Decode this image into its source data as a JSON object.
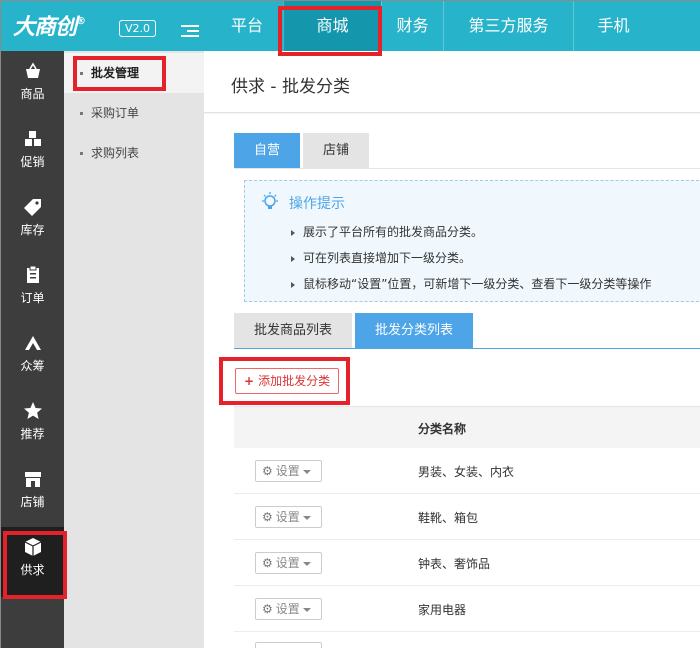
{
  "header": {
    "logo": "大商创",
    "logo_mark": "®",
    "version": "V2.0",
    "nav": [
      {
        "label": "平台"
      },
      {
        "label": "商城"
      },
      {
        "label": "财务"
      },
      {
        "label": "第三方服务"
      },
      {
        "label": "手机"
      }
    ],
    "active_nav": "商城"
  },
  "sidebar": {
    "items": [
      {
        "label": "商品",
        "icon": "basket-icon"
      },
      {
        "label": "促销",
        "icon": "blocks-icon"
      },
      {
        "label": "库存",
        "icon": "tag-icon"
      },
      {
        "label": "订单",
        "icon": "clipboard-icon"
      },
      {
        "label": "众筹",
        "icon": "crowdfund-icon"
      },
      {
        "label": "推荐",
        "icon": "star-icon"
      },
      {
        "label": "店铺",
        "icon": "store-icon"
      },
      {
        "label": "供求",
        "icon": "cube-icon"
      }
    ],
    "active": "供求"
  },
  "subnav": {
    "items": [
      {
        "label": "批发管理"
      },
      {
        "label": "采购订单"
      },
      {
        "label": "求购列表"
      }
    ],
    "active": "批发管理"
  },
  "page": {
    "title": "供求 - 批发分类",
    "tabs_top": [
      {
        "label": "自营"
      },
      {
        "label": "店铺"
      }
    ],
    "tips": {
      "title": "操作提示",
      "lines": [
        "展示了平台所有的批发商品分类。",
        "可在列表直接增加下一级分类。",
        "鼠标移动“设置”位置，可新增下一级分类、查看下一级分类等操作"
      ]
    },
    "tabs_list": [
      {
        "label": "批发商品列表"
      },
      {
        "label": "批发分类列表"
      }
    ],
    "add_button": "添加批发分类",
    "table": {
      "column_name": "分类名称",
      "setting_label": "设置",
      "rows": [
        {
          "name": "男装、女装、内衣"
        },
        {
          "name": "鞋靴、箱包"
        },
        {
          "name": "钟表、奢饰品"
        },
        {
          "name": "家用电器"
        }
      ]
    }
  },
  "colors": {
    "topbar": "#27b3ca",
    "active_tab": "#4da5e8",
    "highlight": "#e5222a",
    "sidebar": "#3d3d3d"
  }
}
